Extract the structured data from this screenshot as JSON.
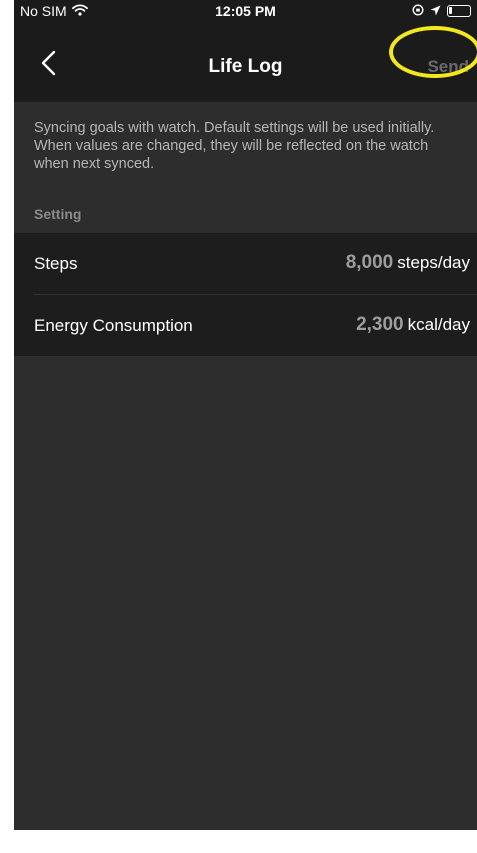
{
  "status_bar": {
    "carrier": "No SIM",
    "time": "12:05 PM"
  },
  "nav": {
    "title": "Life Log",
    "send_label": "Send"
  },
  "info_text": "Syncing goals with watch. Default settings will be used initially. When values are changed, they will be reflected on the watch when next synced.",
  "section": {
    "header": "Setting"
  },
  "settings": [
    {
      "label": "Steps",
      "value": "8,000",
      "unit": "steps/day"
    },
    {
      "label": "Energy Consumption",
      "value": "2,300",
      "unit": "kcal/day"
    }
  ],
  "colors": {
    "highlight": "#f3e81c",
    "background": "#2d2d2d",
    "navbar": "#1b1b1b"
  },
  "icons": {
    "back": "chevron-left-icon",
    "wifi": "wifi-icon",
    "location": "location-arrow-icon",
    "orientation_lock": "orientation-lock-icon",
    "battery": "battery-icon"
  }
}
